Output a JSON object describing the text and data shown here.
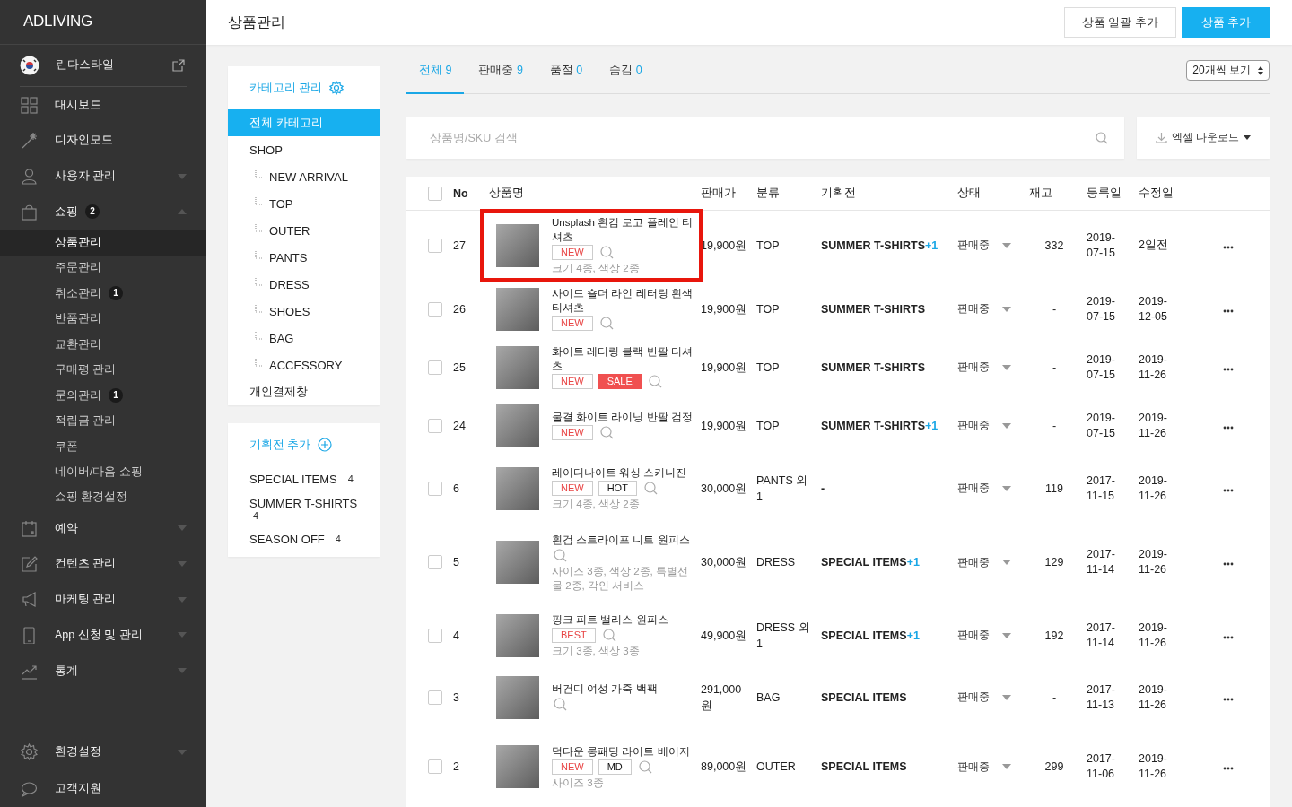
{
  "sidebar": {
    "logo": "ADLIVING",
    "site": {
      "name": "린다스타일"
    },
    "items": [
      {
        "label": "대시보드"
      },
      {
        "label": "디자인모드"
      },
      {
        "label": "사용자 관리",
        "expanded": false
      },
      {
        "label": "쇼핑",
        "badge": "2",
        "expanded": true,
        "children": [
          {
            "label": "상품관리",
            "selected": true
          },
          {
            "label": "주문관리",
            "selected": false
          },
          {
            "label": "취소관리",
            "badge": "1",
            "selected": false
          },
          {
            "label": "반품관리",
            "selected": false
          },
          {
            "label": "교환관리",
            "selected": false
          },
          {
            "label": "구매평 관리",
            "selected": false
          },
          {
            "label": "문의관리",
            "badge": "1",
            "selected": false
          },
          {
            "label": "적립금 관리",
            "selected": false
          },
          {
            "label": "쿠폰",
            "selected": false
          },
          {
            "label": "네이버/다음 쇼핑",
            "selected": false
          },
          {
            "label": "쇼핑 환경설정",
            "selected": false
          }
        ]
      },
      {
        "label": "예약",
        "expanded": false
      },
      {
        "label": "컨텐츠 관리",
        "expanded": false
      },
      {
        "label": "마케팅 관리",
        "expanded": false
      },
      {
        "label": "App 신청 및 관리",
        "expanded": false
      },
      {
        "label": "통계",
        "expanded": false
      }
    ],
    "bottom_items": [
      {
        "label": "환경설정",
        "expanded": false
      },
      {
        "label": "고객지원"
      }
    ]
  },
  "header": {
    "title": "상품관리",
    "buttons": [
      {
        "label": "상품 일괄 추가",
        "kind": "secondary"
      },
      {
        "label": "상품 추가",
        "kind": "primary"
      }
    ]
  },
  "categories": {
    "title": "카테고리 관리",
    "items": [
      {
        "label": "전체 카테고리",
        "selected": true
      },
      {
        "label": "SHOP",
        "selected": false,
        "children": [
          {
            "label": "NEW ARRIVAL",
            "selected": false
          },
          {
            "label": "TOP",
            "selected": false
          },
          {
            "label": "OUTER",
            "selected": false
          },
          {
            "label": "PANTS",
            "selected": false
          },
          {
            "label": "DRESS",
            "selected": false
          },
          {
            "label": "SHOES",
            "selected": false
          },
          {
            "label": "BAG",
            "selected": false
          },
          {
            "label": "ACCESSORY",
            "selected": false
          }
        ]
      },
      {
        "label": "개인결제창",
        "selected": false
      }
    ]
  },
  "promotions": {
    "title": "기획전 추가",
    "items": [
      {
        "name": "SPECIAL ITEMS",
        "count": "4"
      },
      {
        "name": "SUMMER T-SHIRTS",
        "count": "4"
      },
      {
        "name": "SEASON OFF",
        "count": "4"
      }
    ]
  },
  "tabs": [
    {
      "label": "전체",
      "count": "9",
      "selected": true
    },
    {
      "label": "판매중",
      "count": "9",
      "selected": false
    },
    {
      "label": "품절",
      "count": "0",
      "selected": false
    },
    {
      "label": "숨김",
      "count": "0",
      "selected": false
    }
  ],
  "page_size": "20개씩 보기",
  "search": {
    "placeholder": "상품명/SKU 검색"
  },
  "excel_button": "엑셀 다운로드",
  "table": {
    "select_all": {
      "checked": false
    },
    "columns": [
      "No",
      "상품명",
      "판매가",
      "분류",
      "기획전",
      "상태",
      "재고",
      "등록일",
      "수정일"
    ],
    "rows": [
      {
        "checked": false,
        "highlighted": true,
        "no": "27",
        "name": "Unsplash 흰검 로고 플레인 티셔츠",
        "tags": [
          {
            "label": "NEW",
            "kind": "red"
          }
        ],
        "options": "크기 4종, 색상 2종",
        "price": "19,900원",
        "category": "TOP",
        "promo": "SUMMER T-SHIRTS",
        "promo_more": "+1",
        "status": "판매중",
        "stock": "332",
        "registered": "2019-07-15",
        "modified": "2일전"
      },
      {
        "checked": false,
        "highlighted": false,
        "no": "26",
        "name": "사이드 숄더 라인 레터링 흰색 티셔츠",
        "tags": [
          {
            "label": "NEW",
            "kind": "red"
          }
        ],
        "price": "19,900원",
        "category": "TOP",
        "promo": "SUMMER T-SHIRTS",
        "status": "판매중",
        "stock": "-",
        "registered": "2019-07-15",
        "modified": "2019-12-05"
      },
      {
        "checked": false,
        "highlighted": false,
        "no": "25",
        "name": "화이트 레터링 블랙 반팔 티셔츠",
        "tags": [
          {
            "label": "NEW",
            "kind": "red"
          },
          {
            "label": "SALE",
            "kind": "filled"
          }
        ],
        "price": "19,900원",
        "category": "TOP",
        "promo": "SUMMER T-SHIRTS",
        "status": "판매중",
        "stock": "-",
        "registered": "2019-07-15",
        "modified": "2019-11-26"
      },
      {
        "checked": false,
        "highlighted": false,
        "no": "24",
        "name": "물결 화이트 라이닝 반팔 검정",
        "tags": [
          {
            "label": "NEW",
            "kind": "red"
          }
        ],
        "price": "19,900원",
        "category": "TOP",
        "promo": "SUMMER T-SHIRTS",
        "promo_more": "+1",
        "status": "판매중",
        "stock": "-",
        "registered": "2019-07-15",
        "modified": "2019-11-26"
      },
      {
        "checked": false,
        "highlighted": false,
        "no": "6",
        "name": "레이디나이트 워싱 스키니진",
        "tags": [
          {
            "label": "NEW",
            "kind": "red"
          },
          {
            "label": "HOT",
            "kind": "dark"
          }
        ],
        "options": "크기 4종, 색상 2종",
        "price": "30,000원",
        "category": "PANTS 외 1",
        "promo": "-",
        "status": "판매중",
        "stock": "119",
        "registered": "2017-11-15",
        "modified": "2019-11-26"
      },
      {
        "checked": false,
        "highlighted": false,
        "no": "5",
        "name": "흰검 스트라이프 니트 원피스",
        "tags": [],
        "options": "사이즈 3종, 색상 2종, 특별선물 2종, 각인 서비스",
        "price": "30,000원",
        "category": "DRESS",
        "promo": "SPECIAL ITEMS",
        "promo_more": "+1",
        "status": "판매중",
        "stock": "129",
        "registered": "2017-11-14",
        "modified": "2019-11-26"
      },
      {
        "checked": false,
        "highlighted": false,
        "no": "4",
        "name": "핑크 피트 밸리스 원피스",
        "tags": [
          {
            "label": "BEST",
            "kind": "red"
          }
        ],
        "options": "크기 3종, 색상 3종",
        "price": "49,900원",
        "category": "DRESS 외 1",
        "promo": "SPECIAL ITEMS",
        "promo_more": "+1",
        "status": "판매중",
        "stock": "192",
        "registered": "2017-11-14",
        "modified": "2019-11-26"
      },
      {
        "checked": false,
        "highlighted": false,
        "no": "3",
        "name": "버건디 여성 가죽 백팩",
        "tags": [],
        "price": "291,000원",
        "category": "BAG",
        "promo": "SPECIAL ITEMS",
        "status": "판매중",
        "stock": "-",
        "registered": "2017-11-13",
        "modified": "2019-11-26"
      },
      {
        "checked": false,
        "highlighted": false,
        "no": "2",
        "name": "덕다운 롱패딩 라이트 베이지",
        "tags": [
          {
            "label": "NEW",
            "kind": "red"
          },
          {
            "label": "MD",
            "kind": "dark"
          }
        ],
        "options": "사이즈 3종",
        "price": "89,000원",
        "category": "OUTER",
        "promo": "SPECIAL ITEMS",
        "status": "판매중",
        "stock": "299",
        "registered": "2017-11-06",
        "modified": "2019-11-26"
      }
    ]
  }
}
